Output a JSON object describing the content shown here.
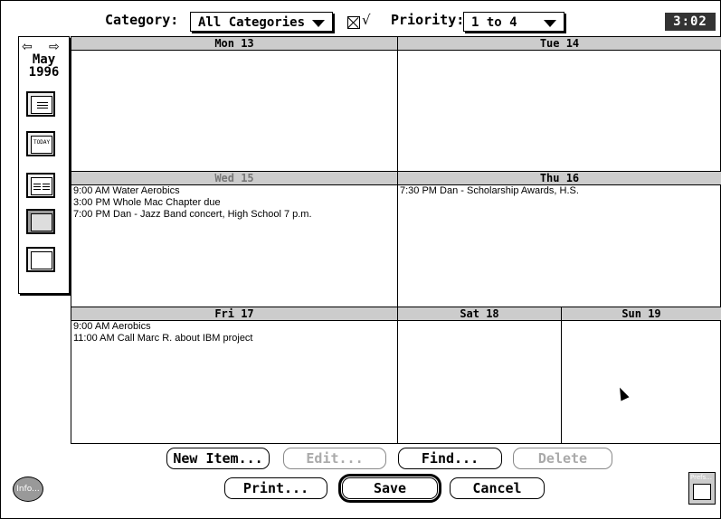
{
  "toolbar": {
    "category_label": "Category:",
    "category_value": "All Categories",
    "priority_label": "Priority:",
    "priority_value": "1 to 4",
    "check_symbol": "√",
    "clock": "3:02"
  },
  "sidebar": {
    "month": "May",
    "year": "1996",
    "today_label": "TODAY"
  },
  "days": [
    {
      "label": "Mon 13",
      "events": []
    },
    {
      "label": "Tue 14",
      "events": []
    },
    {
      "label": "Wed 15",
      "events": [
        "9:00 AM Water Aerobics",
        "3:00 PM Whole Mac Chapter due",
        "7:00 PM Dan - Jazz Band concert, High School 7 p.m."
      ]
    },
    {
      "label": "Thu 16",
      "events": [
        "7:30 PM Dan - Scholarship Awards, H.S."
      ]
    },
    {
      "label": "Fri 17",
      "events": [
        "9:00 AM Aerobics",
        "11:00 AM Call Marc R. about IBM project"
      ]
    },
    {
      "label": "Sat 18",
      "events": []
    },
    {
      "label": "Sun 19",
      "events": []
    }
  ],
  "buttons": {
    "new_item": "New Item...",
    "edit": "Edit...",
    "find": "Find...",
    "delete": "Delete",
    "print": "Print...",
    "save": "Save",
    "cancel": "Cancel"
  },
  "info_label": "Info...",
  "prefs_label": "Prefs..."
}
